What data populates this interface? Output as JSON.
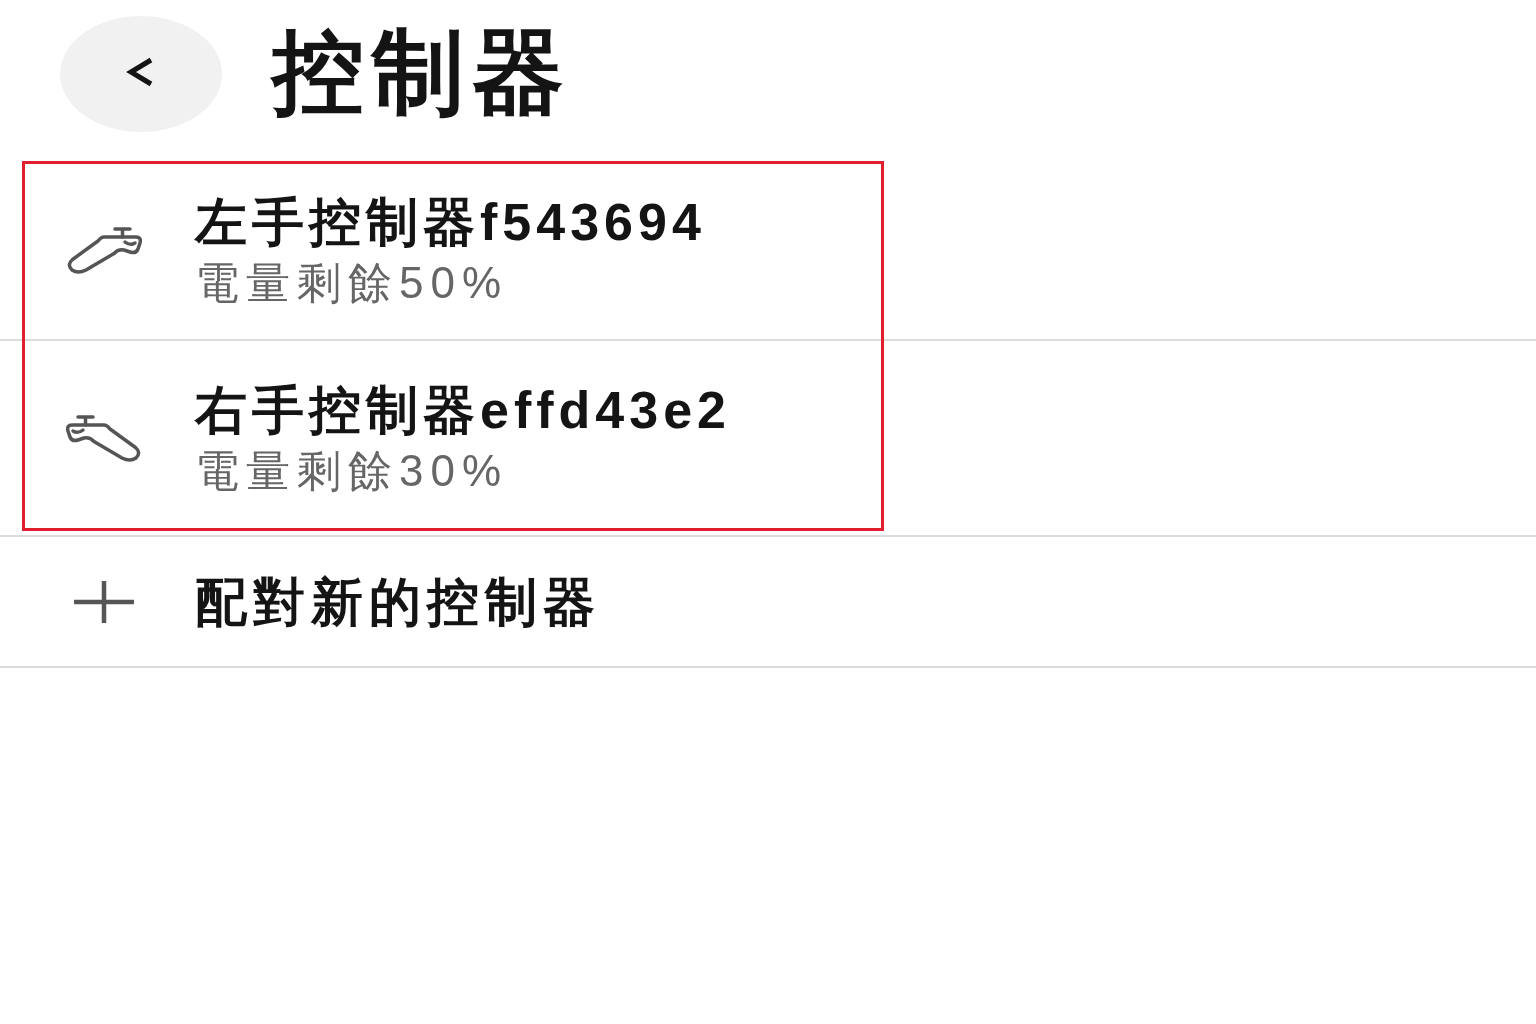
{
  "header": {
    "title": "控制器"
  },
  "controllers": {
    "highlighted": true,
    "items": [
      {
        "kind": "left",
        "name": "左手控制器f543694",
        "battery": "電量剩餘50%"
      },
      {
        "kind": "right",
        "name": "右手控制器effd43e2",
        "battery": "電量剩餘30%"
      }
    ]
  },
  "add_controller": {
    "label": "配對新的控制器"
  }
}
